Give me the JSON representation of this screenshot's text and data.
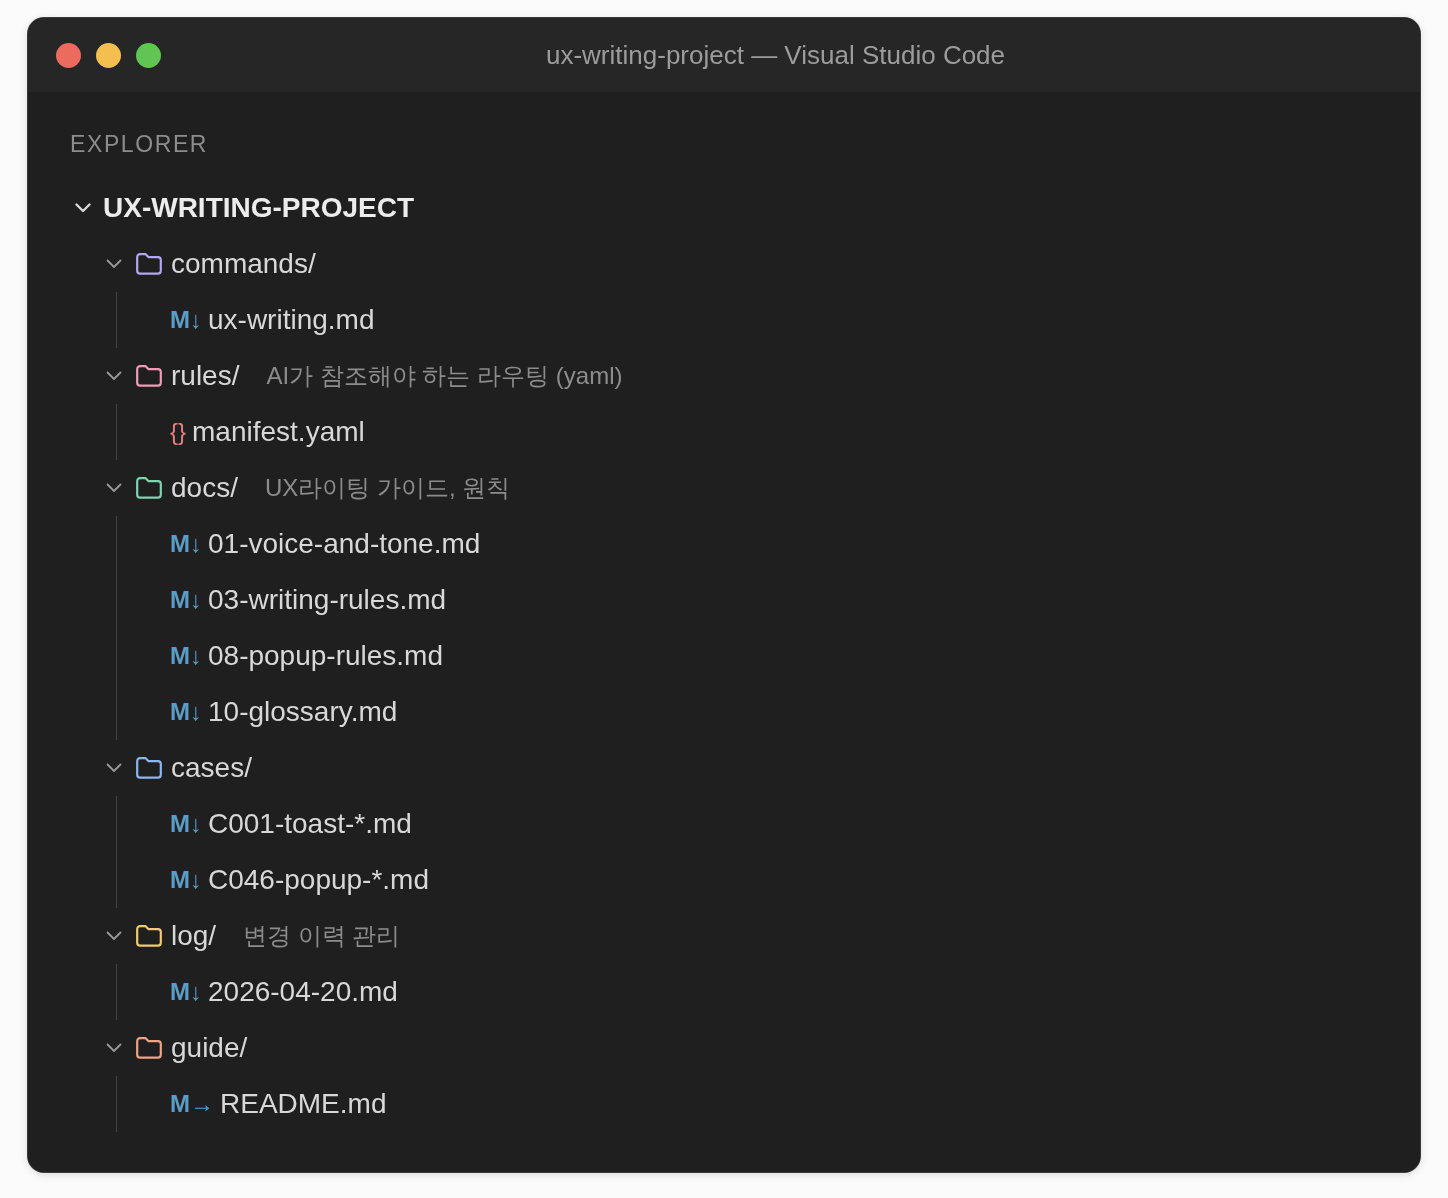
{
  "window": {
    "title": "ux-writing-project — Visual Studio Code"
  },
  "explorer": {
    "title": "EXPLORER",
    "root": {
      "name": "UX-WRITING-PROJECT",
      "expanded": true,
      "children": [
        {
          "kind": "folder",
          "name": "commands/",
          "color": "#b3a6f2",
          "expanded": true,
          "children": [
            {
              "kind": "markdown",
              "icon": "M↓",
              "name": "ux-writing.md"
            }
          ]
        },
        {
          "kind": "folder",
          "name": "rules/",
          "note": "AI가 참조해야 하는 라우팅 (yaml)",
          "color": "#f29bb6",
          "expanded": true,
          "children": [
            {
              "kind": "yaml",
              "icon": "{}",
              "name": "manifest.yaml"
            }
          ]
        },
        {
          "kind": "folder",
          "name": "docs/",
          "note": "UX라이팅 가이드, 원칙",
          "color": "#7fd3b1",
          "expanded": true,
          "children": [
            {
              "kind": "markdown",
              "icon": "M↓",
              "name": "01-voice-and-tone.md"
            },
            {
              "kind": "markdown",
              "icon": "M↓",
              "name": "03-writing-rules.md"
            },
            {
              "kind": "markdown",
              "icon": "M↓",
              "name": "08-popup-rules.md"
            },
            {
              "kind": "markdown",
              "icon": "M↓",
              "name": "10-glossary.md"
            }
          ]
        },
        {
          "kind": "folder",
          "name": "cases/",
          "color": "#8cb6f2",
          "expanded": true,
          "children": [
            {
              "kind": "markdown",
              "icon": "M↓",
              "name": "C001-toast-*.md"
            },
            {
              "kind": "markdown",
              "icon": "M↓",
              "name": "C046-popup-*.md"
            }
          ]
        },
        {
          "kind": "folder",
          "name": "log/",
          "note": "변경 이력 관리",
          "color": "#f2c96f",
          "expanded": true,
          "children": [
            {
              "kind": "markdown",
              "icon": "M↓",
              "name": "2026-04-20.md"
            }
          ]
        },
        {
          "kind": "folder",
          "name": "guide/",
          "color": "#f0a283",
          "expanded": true,
          "children": [
            {
              "kind": "markdown",
              "icon": "M→",
              "name": "README.md"
            }
          ]
        }
      ]
    }
  }
}
